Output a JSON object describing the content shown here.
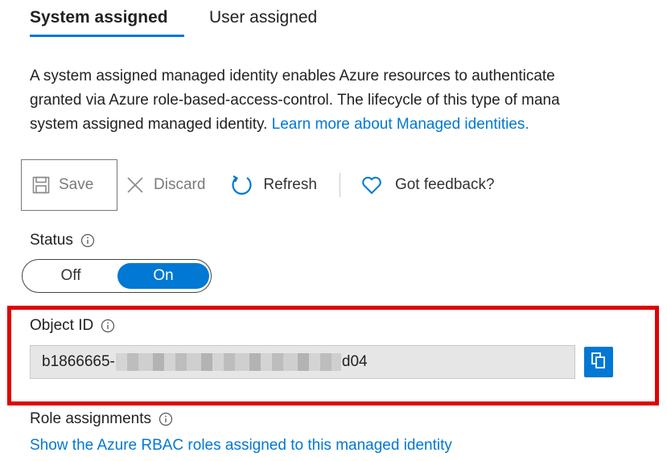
{
  "tabs": {
    "system_assigned": "System assigned",
    "user_assigned": "User assigned"
  },
  "description": {
    "line1": "A system assigned managed identity enables Azure resources to authenticate",
    "line2": "granted via Azure role-based-access-control. The lifecycle of this type of mana",
    "line3": "system assigned managed identity.",
    "learn_more": "Learn more about Managed identities."
  },
  "toolbar": {
    "save_label": "Save",
    "discard_label": "Discard",
    "refresh_label": "Refresh",
    "feedback_label": "Got feedback?"
  },
  "status": {
    "label": "Status",
    "off_label": "Off",
    "on_label": "On",
    "value": "On"
  },
  "object_id": {
    "label": "Object ID",
    "value_prefix": "b1866665-",
    "value_suffix": "d04"
  },
  "role_assignments": {
    "label": "Role assignments",
    "link": "Show the Azure RBAC roles assigned to this managed identity"
  },
  "colors": {
    "accent": "#0078d4",
    "highlight": "#e00000"
  },
  "icons": {
    "save": "save-icon",
    "discard": "close-icon",
    "refresh": "refresh-icon",
    "feedback": "heart-icon",
    "info": "info-icon",
    "copy": "copy-icon"
  }
}
